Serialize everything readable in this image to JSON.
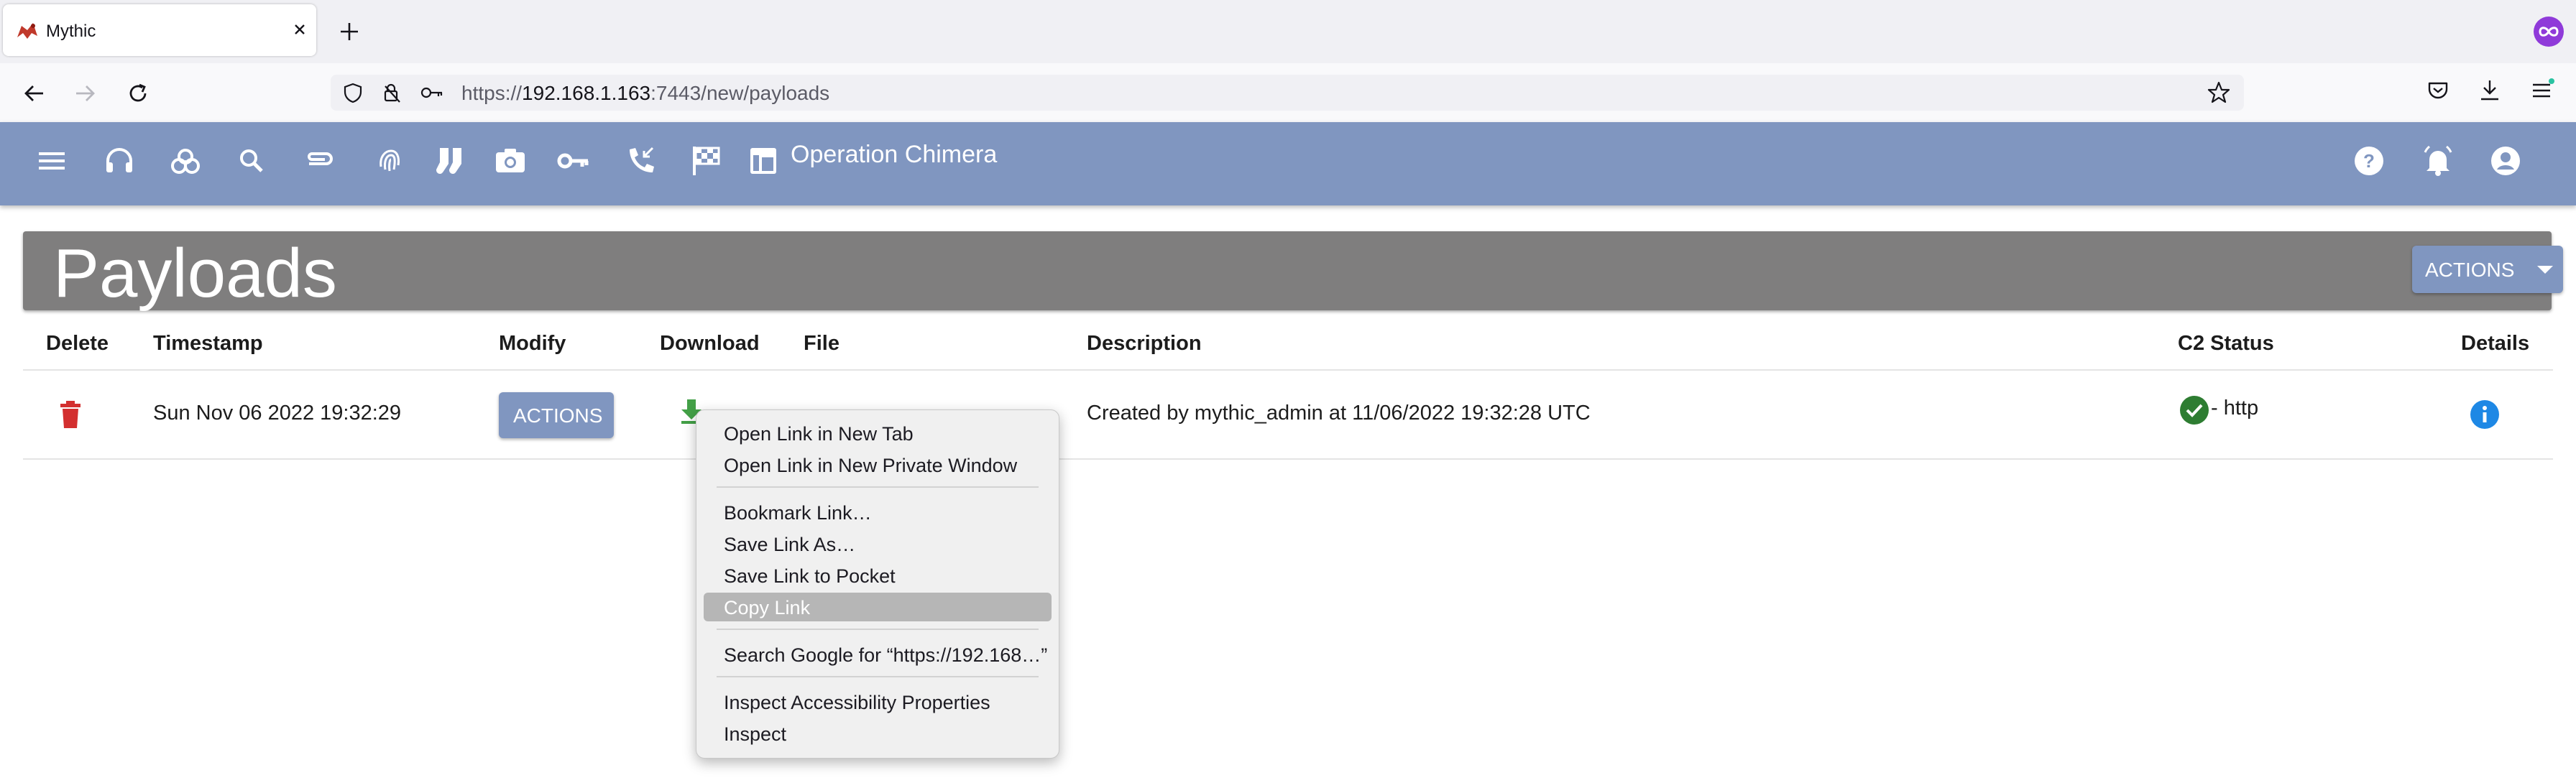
{
  "browser": {
    "tab_title": "Mythic",
    "url_scheme": "https://",
    "url_host": "192.168.1.163",
    "url_rest": ":7443/new/payloads"
  },
  "toolbar": {
    "operation_name": "Operation Chimera"
  },
  "page": {
    "title": "Payloads",
    "actions_label": "ACTIONS"
  },
  "table": {
    "headers": {
      "delete": "Delete",
      "timestamp": "Timestamp",
      "modify": "Modify",
      "download": "Download",
      "file": "File",
      "description": "Description",
      "c2_status": "C2 Status",
      "details": "Details"
    },
    "rows": [
      {
        "timestamp": "Sun Nov 06 2022 19:32:29",
        "modify_label": "ACTIONS",
        "description": "Created by mythic_admin at 11/06/2022 19:32:28 UTC",
        "c2_status": "- http"
      }
    ]
  },
  "context_menu": {
    "items": [
      "Open Link in New Tab",
      "Open Link in New Private Window",
      "Bookmark Link…",
      "Save Link As…",
      "Save Link to Pocket",
      "Copy Link",
      "Search Google for “https://192.168…”",
      "Inspect Accessibility Properties",
      "Inspect"
    ],
    "highlighted": "Copy Link"
  },
  "colors": {
    "app_toolbar": "#8096c0",
    "header_band": "#7f7e7e",
    "delete_red": "#d32f2f",
    "download_green": "#43a047",
    "status_green": "#2e7d32",
    "info_blue": "#1e88e5"
  }
}
